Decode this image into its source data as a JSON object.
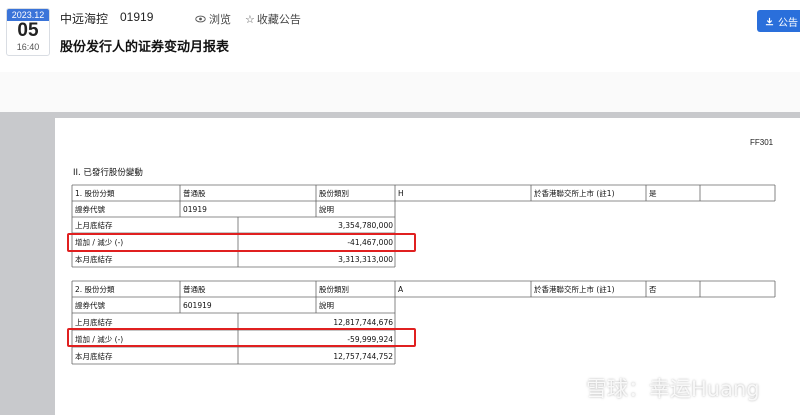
{
  "header": {
    "date_month": "2023.12",
    "date_day": "05",
    "date_time": "16:40",
    "company": "中远海控",
    "code": "01919",
    "browse_label": "浏览",
    "collect_label": "收藏公告",
    "title": "股份发行人的证券变动月报表",
    "announce_label": "公告"
  },
  "doc": {
    "form_code": "FF301",
    "section_title": "II. 已發行股份變動",
    "block1": {
      "class_label": "1. 股份分類",
      "class_value": "普通股",
      "category_label": "股份類別",
      "category_value": "H",
      "listed_label": "於香港聯交所上市 (註1)",
      "listed_value": "是",
      "code_label": "證券代號",
      "code_value": "01919",
      "desc_label": "說明",
      "prev_label": "上月底結存",
      "prev_value": "3,354,780,000",
      "change_label": "增加 / 減少 (-)",
      "change_value": "-41,467,000",
      "curr_label": "本月底結存",
      "curr_value": "3,313,313,000"
    },
    "block2": {
      "class_label": "2. 股份分類",
      "class_value": "普通股",
      "category_label": "股份類別",
      "category_value": "A",
      "listed_label": "於香港聯交所上市 (註1)",
      "listed_value": "否",
      "code_label": "證券代號",
      "code_value": "601919",
      "desc_label": "說明",
      "prev_label": "上月底結存",
      "prev_value": "12,817,744,676",
      "change_label": "增加 / 減少 (-)",
      "change_value": "-59,999,924",
      "curr_label": "本月底結存",
      "curr_value": "12,757,744,752"
    }
  },
  "watermark": "雪球：幸运Huang"
}
